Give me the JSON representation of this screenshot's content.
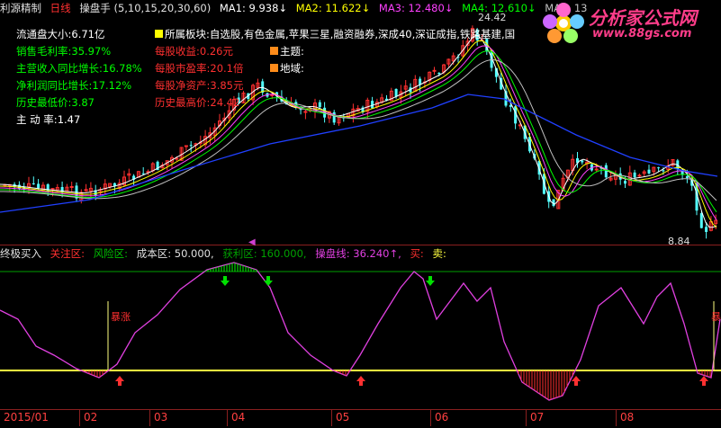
{
  "topbar": {
    "app": "利源精制",
    "period": "日线",
    "indicator": "操盘手",
    "params": "(5,10,15,20,30,60)",
    "ma1": "MA1: 9.938↓",
    "ma2": "MA2: 11.622↓",
    "ma3": "MA3: 12.480↓",
    "ma4": "MA4: 12.610↓",
    "ma5": "MA5: 13"
  },
  "watermark": {
    "brand": "分析家公式网",
    "url": "www.88gs.com"
  },
  "left_panel": [
    {
      "label": "流通盘大小:",
      "value": "6.71亿"
    },
    {
      "label": "销售毛利率:",
      "value": "35.97%"
    },
    {
      "label": "主营收入同比增长:",
      "value": "16.78%"
    },
    {
      "label": "净利润同比增长:",
      "value": "17.12%"
    },
    {
      "label": "历史最低价:",
      "value": "3.87"
    },
    {
      "label": "主 动 率:",
      "value": "1.47"
    }
  ],
  "mid_panel": {
    "sector_label": "所属板块:",
    "sector_value": "自选股,有色金属,苹果三星,融资融券,深成40,深证成指,铁路基建,国",
    "eps": "每股收益:0.26元",
    "pe": "每股市盈率:20.1倍",
    "nav": "每股净资产:3.85元",
    "high": "历史最高价:24.42",
    "theme": "主题:",
    "region": "地域:"
  },
  "price_labels": {
    "high": "24.42",
    "low": "8.84"
  },
  "lower_header": {
    "title": "终极买入",
    "attention": "关注区:",
    "risk": "风险区:",
    "cost": "成本区: 50.000,",
    "profit": "获利区: 160.000,",
    "control": "操盘线: 36.240↑,",
    "buy": "买:",
    "sell": "卖:"
  },
  "signal_text": "暴涨",
  "xaxis": [
    "2015/01",
    "02",
    "03",
    "04",
    "05",
    "06",
    "07",
    "08"
  ],
  "colors": {
    "up": "#ff3030",
    "down": "#54ffff",
    "ma1": "#ffffff",
    "ma2": "#ffff00",
    "ma3": "#ff40ff",
    "ma4": "#00ff00",
    "ma60": "#2040ff",
    "control": "#e040e0",
    "green_line": "#00a000",
    "yellow_line": "#ffff40"
  }
}
